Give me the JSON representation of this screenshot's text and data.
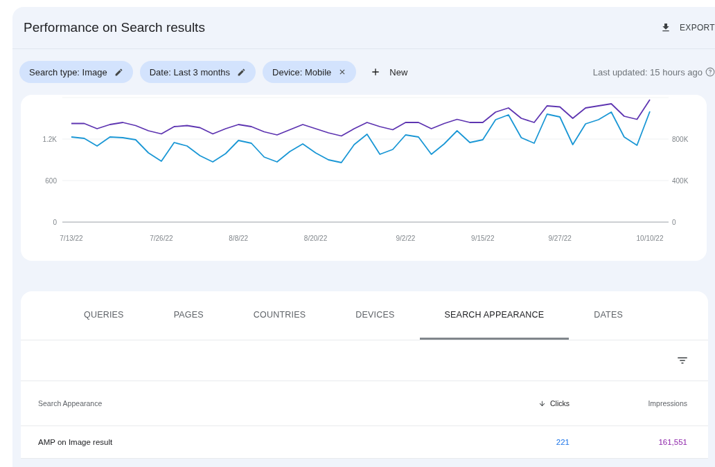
{
  "header": {
    "title": "Performance on Search results",
    "export_label": "EXPORT"
  },
  "filters": [
    {
      "label": "Search type: Image",
      "kind": "editable"
    },
    {
      "label": "Date: Last 3 months",
      "kind": "editable"
    },
    {
      "label": "Device: Mobile",
      "kind": "removable"
    }
  ],
  "new_filter": {
    "label": "New"
  },
  "last_updated": "Last updated: 15 hours ago",
  "performance_chart": {
    "chart_data": {
      "type": "line",
      "categories": [
        "7/13/22",
        null,
        null,
        null,
        null,
        null,
        null,
        "7/26/22",
        null,
        null,
        null,
        null,
        null,
        "8/8/22",
        null,
        null,
        null,
        null,
        null,
        "8/20/22",
        null,
        null,
        null,
        null,
        null,
        null,
        "9/2/22",
        null,
        null,
        null,
        null,
        null,
        "9/15/22",
        null,
        null,
        null,
        null,
        null,
        "9/27/22",
        null,
        null,
        null,
        null,
        null,
        null,
        "10/10/22"
      ],
      "yticks": [
        {
          "value": 0,
          "label": "0"
        },
        {
          "value": 600,
          "label": "600"
        },
        {
          "value": 1200,
          "label": "1.2K"
        }
      ],
      "ylim": [
        0,
        1800
      ],
      "y2ticks": [
        {
          "value": 0,
          "label": "0"
        },
        {
          "value": 400000,
          "label": "400K"
        },
        {
          "value": 800000,
          "label": "800K"
        }
      ],
      "y2lim": [
        0,
        1200000
      ],
      "series": [
        {
          "color": "#1a97d5",
          "values": [
            1230,
            1210,
            1100,
            1230,
            1220,
            1190,
            1000,
            880,
            1150,
            1100,
            960,
            870,
            990,
            1180,
            1140,
            940,
            870,
            1020,
            1130,
            1000,
            900,
            860,
            1120,
            1270,
            980,
            1050,
            1260,
            1230,
            980,
            1130,
            1320,
            1150,
            1190,
            1480,
            1550,
            1220,
            1140,
            1560,
            1520,
            1120,
            1420,
            1480,
            1590,
            1230,
            1110,
            1600
          ]
        },
        {
          "color": "#5e35b1",
          "axis": "y2",
          "values": [
            950000,
            950000,
            900000,
            940000,
            960000,
            930000,
            880000,
            850000,
            920000,
            930000,
            910000,
            850000,
            900000,
            940000,
            920000,
            870000,
            840000,
            890000,
            940000,
            900000,
            860000,
            830000,
            900000,
            960000,
            920000,
            890000,
            960000,
            960000,
            900000,
            950000,
            990000,
            960000,
            960000,
            1060000,
            1100000,
            1000000,
            960000,
            1120000,
            1110000,
            1000000,
            1100000,
            1120000,
            1140000,
            1020000,
            990000,
            1180000
          ]
        }
      ]
    }
  },
  "tabs": [
    {
      "label": "QUERIES",
      "selected": false
    },
    {
      "label": "PAGES",
      "selected": false
    },
    {
      "label": "COUNTRIES",
      "selected": false
    },
    {
      "label": "DEVICES",
      "selected": false
    },
    {
      "label": "SEARCH APPEARANCE",
      "selected": true
    },
    {
      "label": "DATES",
      "selected": false
    }
  ],
  "table": {
    "columns": [
      {
        "label": "Search Appearance",
        "kind": "text",
        "sorted": false
      },
      {
        "label": "Clicks",
        "kind": "clicks",
        "sorted": true
      },
      {
        "label": "Impressions",
        "kind": "impressions",
        "sorted": false
      }
    ],
    "rows": [
      [
        "AMP on Image result",
        "221",
        "161,551"
      ]
    ]
  }
}
